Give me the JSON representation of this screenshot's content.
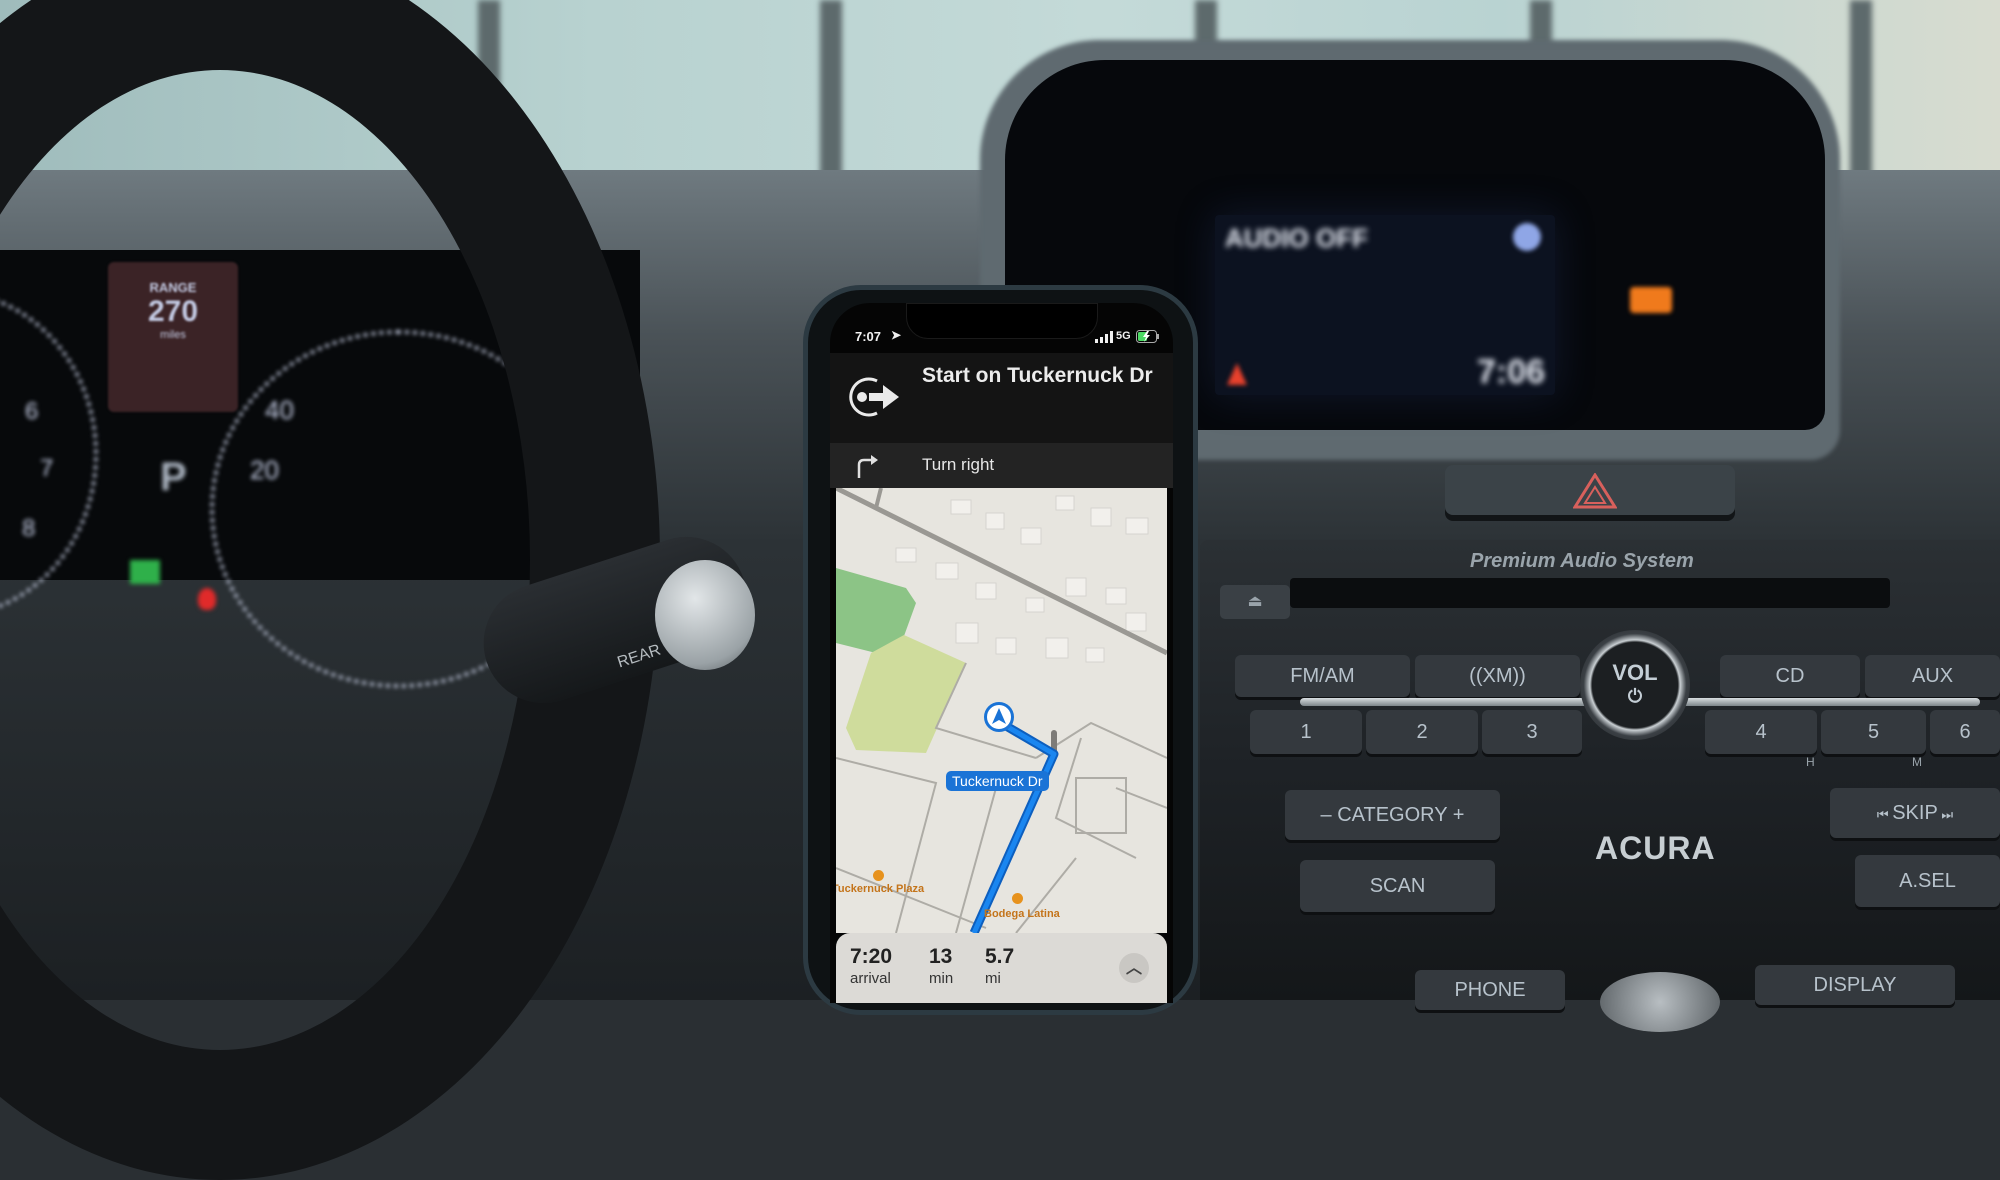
{
  "phone": {
    "status_bar": {
      "time": "7:07",
      "location_icon": "location-arrow-icon",
      "signal_icon": "cellular-signal-icon",
      "network": "5G",
      "battery_icon": "battery-charging-icon"
    },
    "navigation": {
      "primary_instruction": "Start on Tuckernuck Dr",
      "primary_icon": "start-route-icon",
      "next_instruction": "Turn right",
      "next_icon": "turn-right-icon"
    },
    "map": {
      "route_label": "Tuckernuck Dr",
      "user_marker_icon": "navigation-arrow-icon",
      "pois": [
        {
          "name": "Tuckernuck Plaza",
          "icon": "shopping-bag-icon"
        },
        {
          "name": "Bodega Latina",
          "icon": "store-icon"
        }
      ],
      "colors": {
        "route": "#1a73d6",
        "park": "#8cc486",
        "field": "#cfdc9c",
        "road": "#9a9893",
        "land": "#e7e5df"
      }
    },
    "eta": {
      "arrival_value": "7:20",
      "arrival_label": "arrival",
      "duration_value": "13",
      "duration_label": "min",
      "distance_value": "5.7",
      "distance_label": "mi",
      "expand_icon": "chevron-up-icon"
    }
  },
  "car": {
    "head_unit_display": {
      "audio_status": "AUDIO OFF",
      "clock": "7:06"
    },
    "cluster": {
      "range_label": "RANGE",
      "range_value": "270",
      "range_unit": "miles",
      "gear": "P",
      "speedometer_ticks": [
        "40",
        "20"
      ],
      "tach_ticks": [
        "6",
        "7",
        "8"
      ]
    },
    "stalk_label": "REAR",
    "audio_panel": {
      "brand_text": "Premium Audio System",
      "eject_icon": "eject-icon",
      "source_buttons": [
        "FM/AM",
        "((XM))",
        "CD",
        "AUX"
      ],
      "volume_knob_label": "VOL",
      "power_icon": "power-icon",
      "preset_buttons": [
        "1",
        "2",
        "3",
        "4",
        "5",
        "6"
      ],
      "clock_setting_labels": [
        "H",
        "M"
      ],
      "category_button": "– CATEGORY +",
      "scan_button": "SCAN",
      "skip_button": "SKIP",
      "asel_button": "A.SEL",
      "phone_button": "PHONE",
      "display_button": "DISPLAY",
      "logo": "ACURA"
    },
    "hazard_icon": "hazard-triangle-icon"
  }
}
